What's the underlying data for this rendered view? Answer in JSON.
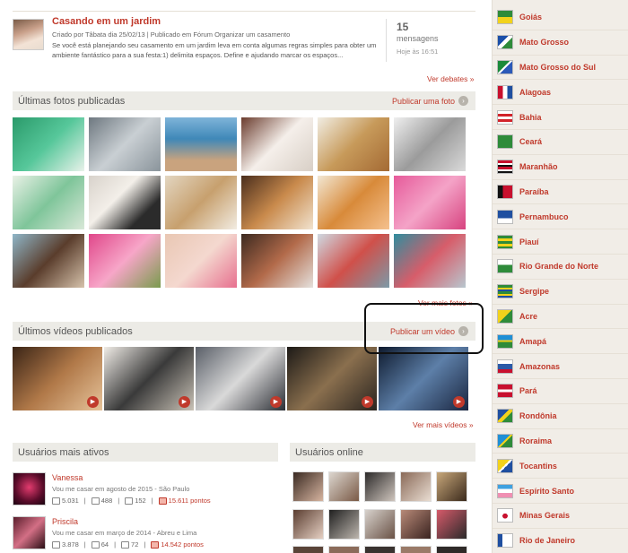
{
  "debate": {
    "title": "Casando em um jardim",
    "meta": "Criado por Tâbata dia 25/02/13 | Publicado em Fórum Organizar um casamento",
    "description": "Se você está planejando seu casamento em um jardim leva em conta algumas regras simples para obter um ambiente fantástico para a sua festa:1) delimita espaços. Define e ajudando marcar os espaços...",
    "count": "15",
    "count_label": "mensagens",
    "time": "Hoje às 16:51",
    "more_link": "Ver debates »"
  },
  "photos": {
    "title": "Últimas fotos publicadas",
    "action": "Publicar uma foto",
    "more_link": "Ver mais fotos »"
  },
  "videos": {
    "title": "Últimos vídeos publicados",
    "action": "Publicar um vídeo",
    "more_link": "Ver mais vídeos »"
  },
  "active_users": {
    "title": "Usuários mais ativos",
    "users": [
      {
        "name": "Vanessa",
        "desc": "Vou me casar em agosto de 2015 - São Paulo",
        "posts": "5.031",
        "photos": "488",
        "friends": "152",
        "points": "15.611 pontos"
      },
      {
        "name": "Priscila",
        "desc": "Vou me casar em março de 2014 - Abreu e Lima",
        "posts": "3.878",
        "photos": "64",
        "friends": "72",
        "points": "14.542 pontos"
      }
    ]
  },
  "online_users": {
    "title": "Usuários online"
  },
  "states": [
    {
      "name": "Goiás",
      "icon": "flag-goias-icon"
    },
    {
      "name": "Mato Grosso",
      "icon": "flag-mato-grosso-icon"
    },
    {
      "name": "Mato Grosso do Sul",
      "icon": "flag-mato-grosso-do-sul-icon"
    },
    {
      "name": "Alagoas",
      "icon": "flag-alagoas-icon"
    },
    {
      "name": "Bahia",
      "icon": "flag-bahia-icon"
    },
    {
      "name": "Ceará",
      "icon": "flag-ceara-icon"
    },
    {
      "name": "Maranhão",
      "icon": "flag-maranhao-icon"
    },
    {
      "name": "Paraíba",
      "icon": "flag-paraiba-icon"
    },
    {
      "name": "Pernambuco",
      "icon": "flag-pernambuco-icon"
    },
    {
      "name": "Piauí",
      "icon": "flag-piaui-icon"
    },
    {
      "name": "Rio Grande do Norte",
      "icon": "flag-rio-grande-do-norte-icon"
    },
    {
      "name": "Sergipe",
      "icon": "flag-sergipe-icon"
    },
    {
      "name": "Acre",
      "icon": "flag-acre-icon"
    },
    {
      "name": "Amapá",
      "icon": "flag-amapa-icon"
    },
    {
      "name": "Amazonas",
      "icon": "flag-amazonas-icon"
    },
    {
      "name": "Pará",
      "icon": "flag-para-icon"
    },
    {
      "name": "Rondônia",
      "icon": "flag-rondonia-icon"
    },
    {
      "name": "Roraima",
      "icon": "flag-roraima-icon"
    },
    {
      "name": "Tocantins",
      "icon": "flag-tocantins-icon"
    },
    {
      "name": "Espírito Santo",
      "icon": "flag-espirito-santo-icon"
    },
    {
      "name": "Minas Gerais",
      "icon": "flag-minas-gerais-icon"
    },
    {
      "name": "Rio de Janeiro",
      "icon": "flag-rio-de-janeiro-icon"
    }
  ],
  "colors": {
    "accent": "#c0392b",
    "section_bar": "#ecebe6",
    "sidebar_bg": "#f1ede7"
  }
}
